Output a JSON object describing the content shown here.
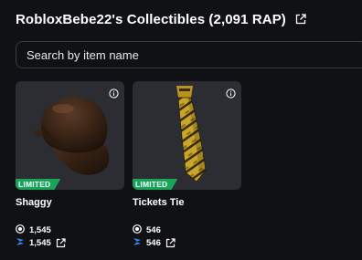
{
  "header": {
    "title": "RobloxBebe22's Collectibles (2,091 RAP)",
    "link_icon": "external-link-icon"
  },
  "search": {
    "placeholder": "Search by item name",
    "value": ""
  },
  "items": [
    {
      "name": "Shaggy",
      "badge": "LIMITED",
      "rap": "1,545",
      "value": "1,545",
      "thumbnail": "brown-cap-hat"
    },
    {
      "name": "Tickets Tie",
      "badge": "LIMITED",
      "rap": "546",
      "value": "546",
      "thumbnail": "yellow-ticket-tie"
    }
  ],
  "colors": {
    "background": "#101114",
    "card": "#2b2d33",
    "limited_badge": "#17a55b",
    "value_icon": "#3b82f6"
  }
}
